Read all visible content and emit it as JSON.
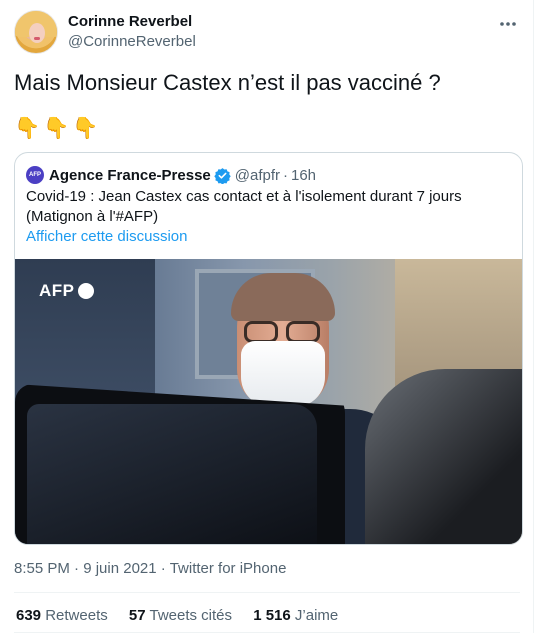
{
  "author": {
    "display_name": "Corinne Reverbel",
    "handle": "@CorinneReverbel",
    "avatar_icon": "profile-photo",
    "more_icon": "more-horizontal-icon"
  },
  "tweet": {
    "text": "Mais Monsieur Castex n’est il pas vacciné ?",
    "emojis": "👇👇👇"
  },
  "quoted_tweet": {
    "avatar_text": "AFP",
    "name": "Agence France-Presse",
    "verified_icon": "verified-badge-icon",
    "handle": "@afpfr",
    "separator": "·",
    "time": "16h",
    "text": "Covid-19 : Jean Castex cas contact et à l'isolement durant 7 jours (Matignon à l'#AFP)",
    "link_label": "Afficher cette discussion",
    "photo_watermark": "AFP"
  },
  "meta": {
    "time": "8:55 PM",
    "separator": "·",
    "date": "9 juin 2021",
    "source": "Twitter for iPhone"
  },
  "stats": [
    {
      "count": "639",
      "label": "Retweets"
    },
    {
      "count": "57",
      "label": "Tweets cités"
    },
    {
      "count": "1 516",
      "label": "J’aime"
    }
  ],
  "colors": {
    "accent": "#1d9bf0",
    "secondary_text": "#536471",
    "border": "#cfd9de"
  }
}
